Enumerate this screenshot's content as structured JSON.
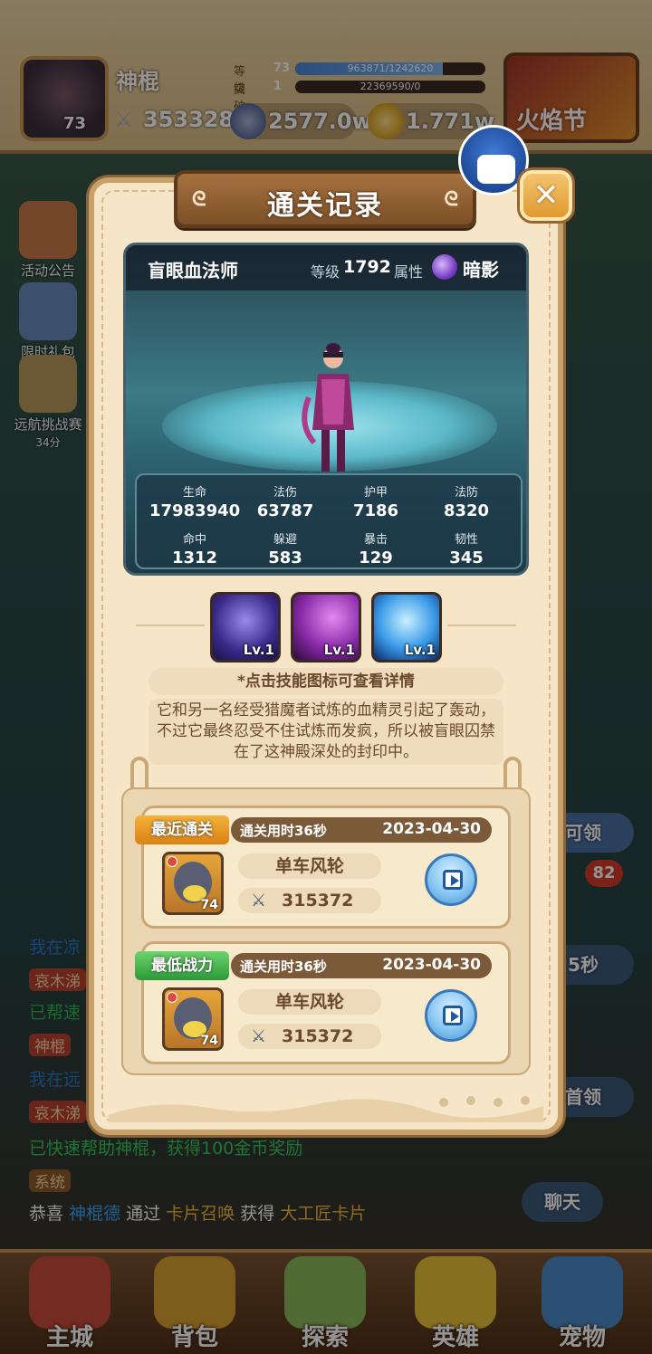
{
  "player": {
    "name": "神棍",
    "avatar_level": "73",
    "power": "353328",
    "level_label": "等级",
    "level_value": "73",
    "level_bar_text": "963871/1242620",
    "level_progress": 0.776,
    "break_label": "突破",
    "break_value": "1",
    "break_bar_text": "22369590/0",
    "break_progress": 0.0
  },
  "currency": {
    "silver": "2577.0w",
    "gold": "1.771w"
  },
  "event": {
    "label": "火焰节"
  },
  "side_left": [
    {
      "label": "活动公告"
    },
    {
      "label": "限时礼包"
    },
    {
      "label": "远航挑战赛",
      "sub": "34分"
    }
  ],
  "side_right": {
    "claim": "可领",
    "badge": "82",
    "timer": "5秒",
    "first_claim": "首领",
    "chat": "聊天"
  },
  "chat": {
    "line1": "我在凉",
    "name_tag1": "哀木涕",
    "line3": "已帮速",
    "name_tag2": "神棍",
    "line5": "我在远",
    "name_tag3": "哀木涕",
    "line7": "已快速帮助神棍，获得100金币奖励",
    "sys_tag": "系统",
    "sys_pre": "恭喜",
    "sys_name": "神棍德",
    "sys_mid": "通过",
    "sys_source": "卡片召唤",
    "sys_get": "获得",
    "sys_item": "大工匠卡片"
  },
  "nav": [
    {
      "label": "主城"
    },
    {
      "label": "背包"
    },
    {
      "label": "探索"
    },
    {
      "label": "英雄"
    },
    {
      "label": "宠物"
    }
  ],
  "modal": {
    "title": "通关记录",
    "close_label": "✕",
    "hero": {
      "name": "盲眼血法师",
      "level_label": "等级",
      "level": "1792",
      "attr_label": "属性",
      "attr": "暗影"
    },
    "stats": [
      {
        "k": "生命",
        "v": "17983940"
      },
      {
        "k": "法伤",
        "v": "63787"
      },
      {
        "k": "护甲",
        "v": "7186"
      },
      {
        "k": "法防",
        "v": "8320"
      },
      {
        "k": "命中",
        "v": "1312"
      },
      {
        "k": "躲避",
        "v": "583"
      },
      {
        "k": "暴击",
        "v": "129"
      },
      {
        "k": "韧性",
        "v": "345"
      }
    ],
    "skills": [
      {
        "lv": "Lv.1",
        "icon": "tentacle-skill-icon"
      },
      {
        "lv": "Lv.1",
        "icon": "claw-skill-icon"
      },
      {
        "lv": "Lv.1",
        "icon": "lightning-skill-icon"
      }
    ],
    "hint": "*点击技能图标可查看详情",
    "description": "它和另一名经受猎魔者试炼的血精灵引起了轰动，不过它最终忍受不住试炼而发疯，所以被盲眼囚禁在了这神殿深处的封印中。",
    "records": [
      {
        "badge": "最近通关",
        "badge_color": "#e8951f",
        "time": "通关用时36秒",
        "date": "2023-04-30",
        "avatar_level": "74",
        "player_name": "单车风轮",
        "power": "315372"
      },
      {
        "badge": "最低战力",
        "badge_color": "#3aa842",
        "time": "通关用时36秒",
        "date": "2023-04-30",
        "avatar_level": "74",
        "player_name": "单车风轮",
        "power": "315372"
      }
    ]
  }
}
